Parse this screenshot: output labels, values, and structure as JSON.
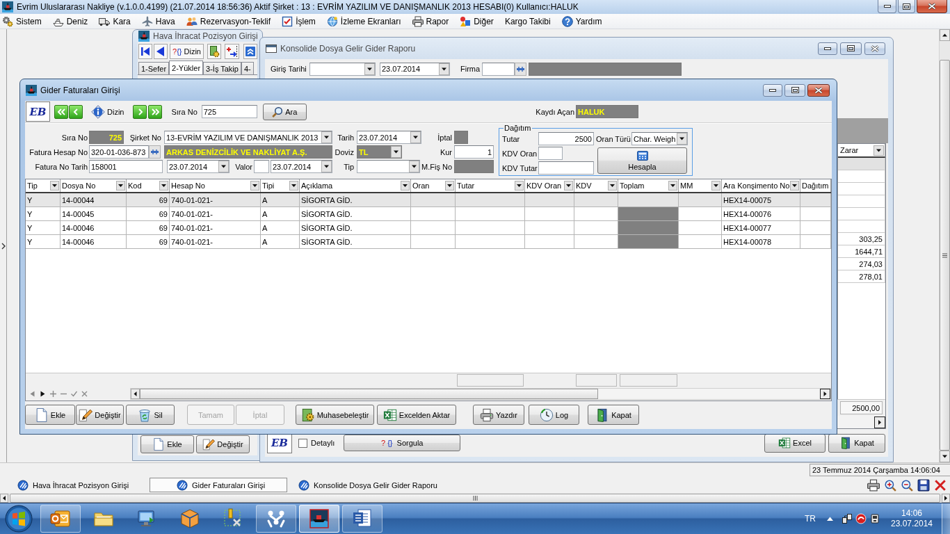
{
  "app_window": {
    "title": "Evrim Uluslararası Nakliye (v.1.0.0.4199) (21.07.2014 18:56:36) Aktif Şirket : 13 : EVRİM YAZILIM VE DANIŞMANLIK 2013 HESABI(0) Kullanıcı:HALUK",
    "active": true
  },
  "menu": [
    "Sistem",
    "Deniz",
    "Kara",
    "Hava",
    "Rezervasyon-Teklif",
    "İşlem",
    "İzleme Ekranları",
    "Rapor",
    "Diğer",
    "Kargo Takibi",
    "Yardım"
  ],
  "hava_window": {
    "title": "Hava İhracat Pozisyon Girişi",
    "active": false,
    "dizin_glyph": "?{}",
    "dizin_button": "Dizin",
    "tabs": [
      {
        "label": "1-Sefer",
        "selected": false
      },
      {
        "label": "2-Yükler",
        "selected": true
      },
      {
        "label": "3-İş Takip",
        "selected": false
      },
      {
        "label": "4-",
        "selected": false
      }
    ],
    "buttons": [
      "Ekle",
      "Değiştir"
    ]
  },
  "konsolide_window": {
    "title": "Konsolide Dosya Gelir Gider Raporu",
    "active": false,
    "filter": {
      "giris_tarihi_label": "Giriş Tarihi",
      "giris_tarihi_end": "23.07.2014",
      "firma_label": "Firma"
    },
    "grid": {
      "column": "Zarar",
      "rows": [
        {
          "selected": true
        },
        {
          "selected": false
        },
        {
          "selected": false
        },
        {
          "selected": false
        },
        {
          "selected": false
        },
        {
          "selected": false
        },
        {
          "zarar": "303,25",
          "selected": false
        },
        {
          "zarar": "1644,71",
          "selected": false
        },
        {
          "zarar": "274,03",
          "selected": false
        },
        {
          "zarar": "278,01",
          "selected": false
        }
      ],
      "total": "2500,00"
    },
    "footer": {
      "logo": "EB",
      "detayli": {
        "label": "Detaylı",
        "checked": false
      },
      "sorgula_glyph": "?{}",
      "sorgula_button": "Sorgula",
      "excel_button": "Excel",
      "kapat_button": "Kapat"
    }
  },
  "gider_window": {
    "title": "Gider Faturaları Girişi",
    "active": true,
    "toolbar": {
      "logo": "EB",
      "dizin_button": "Dizin",
      "sira_no_label": "Sıra No",
      "sira_no": "725",
      "ara_button": "Ara",
      "kaydi_acan_label": "Kaydı Açan",
      "kaydi_acan": "HALUK"
    },
    "form": {
      "sira_no_label": "Sıra No",
      "sira_no": "725",
      "sirket_no_label": "Şirket No",
      "sirket_no": "13-EVRİM YAZILIM VE DANIŞMANLIK 2013",
      "tarih_label": "Tarih",
      "tarih": "23.07.2014",
      "iptal_label": "İptal",
      "fatura_hesap_no_label": "Fatura Hesap No",
      "fatura_hesap_no": "320-01-036-873",
      "firma_adi": "ARKAS DENİZCİLİK VE NAKLİYAT A.Ş.",
      "doviz_label": "Doviz",
      "doviz": "TL",
      "kur_label": "Kur",
      "kur": "1",
      "fatura_no_tarih_label": "Fatura No Tarih",
      "fatura_no": "158001",
      "fatura_tarih": "23.07.2014",
      "valor_label": "Valor",
      "valor_tarih": "23.07.2014",
      "tip_label": "Tip",
      "mfis_no_label": "M.Fiş No"
    },
    "dagitim": {
      "legend": "Dağıtım",
      "tutar_label": "Tutar",
      "tutar": "2500",
      "oran_turu_label": "Oran Türü",
      "oran_turu": "Char. Weigh",
      "kdv_oran_label": "KDV Oran",
      "kdv_tutar_label": "KDV Tutar",
      "hesapla_button": "Hesapla"
    },
    "table": {
      "columns": [
        "Tip",
        "Dosya No",
        "Kod",
        "Hesap No",
        "Tipi",
        "Açıklama",
        "Oran",
        "Tutar",
        "KDV Oran",
        "KDV",
        "Toplam",
        "MM",
        "Ara Konşimento No",
        "Dağıtım"
      ],
      "rows": [
        {
          "tip": "Y",
          "dosya_no": "14-00044",
          "kod": "69",
          "hesap_no": "740-01-021-",
          "tipi": "A",
          "aciklama": "SİGORTA GİD.",
          "ara_konsimento_no": "HEX14-00075",
          "toplam_locked": false,
          "selected": true
        },
        {
          "tip": "Y",
          "dosya_no": "14-00045",
          "kod": "69",
          "hesap_no": "740-01-021-",
          "tipi": "A",
          "aciklama": "SİGORTA GİD.",
          "ara_konsimento_no": "HEX14-00076",
          "toplam_locked": true,
          "selected": false
        },
        {
          "tip": "Y",
          "dosya_no": "14-00046",
          "kod": "69",
          "hesap_no": "740-01-021-",
          "tipi": "A",
          "aciklama": "SİGORTA GİD.",
          "ara_konsimento_no": "HEX14-00077",
          "toplam_locked": true,
          "selected": false
        },
        {
          "tip": "Y",
          "dosya_no": "14-00046",
          "kod": "69",
          "hesap_no": "740-01-021-",
          "tipi": "A",
          "aciklama": "SİGORTA GİD.",
          "ara_konsimento_no": "HEX14-00078",
          "toplam_locked": true,
          "selected": false
        }
      ]
    },
    "buttons": [
      {
        "label": "Ekle",
        "disabled": false
      },
      {
        "label": "Değiştir",
        "disabled": false
      },
      {
        "label": "Sil",
        "disabled": false
      },
      {
        "label": "Tamam",
        "disabled": true
      },
      {
        "label": "İptal",
        "disabled": true
      },
      {
        "label": "Muhasebeleştir",
        "disabled": false
      },
      {
        "label": "Excelden Aktar",
        "disabled": false
      },
      {
        "label": "Yazdır",
        "disabled": false
      },
      {
        "label": "Log",
        "disabled": false
      },
      {
        "label": "Kapat",
        "disabled": false
      }
    ]
  },
  "status_bar": {
    "datetime": "23 Temmuz 2014 Çarşamba 14:06:04"
  },
  "window_tabs": [
    {
      "label": "Hava İhracat Pozisyon Girişi",
      "selected": false
    },
    {
      "label": "Gider Faturaları Girişi",
      "selected": true
    },
    {
      "label": "Konsolide Dosya Gelir Gider Raporu",
      "selected": false
    }
  ],
  "taskbar": {
    "apps": [
      {
        "running": true,
        "selected": false
      },
      {
        "running": false,
        "selected": false
      },
      {
        "running": false,
        "selected": false
      },
      {
        "running": false,
        "selected": false
      },
      {
        "running": false,
        "selected": false
      },
      {
        "running": true,
        "selected": false
      },
      {
        "running": true,
        "selected": true
      },
      {
        "running": true,
        "selected": false
      }
    ],
    "language": "TR",
    "time": "14:06",
    "date": "23.07.2014"
  }
}
